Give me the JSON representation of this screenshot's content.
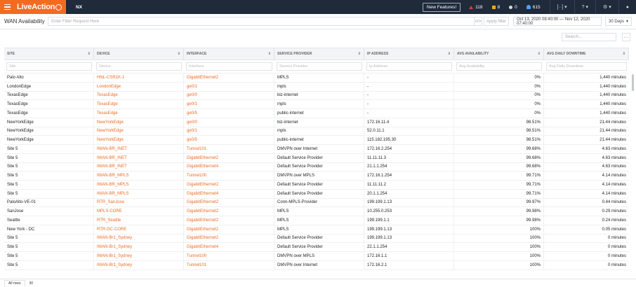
{
  "topbar": {
    "logo": "LiveAction",
    "app": "NX",
    "new_features": "New Features!",
    "alerts_red": "118",
    "alerts_orange": "8",
    "alerts_grey": "0",
    "notifications": "615",
    "colors": {
      "bar": "#1f2a3a",
      "accent": "#f26b21"
    }
  },
  "toolbar": {
    "title": "WAN Availability",
    "filter_placeholder": "Enter Filter Request Here",
    "apply": "Apply filter",
    "date_range": "Oct 13, 2020 08:40:00 — Nov 12, 2020 07:40:00",
    "period": "30 Days"
  },
  "search": {
    "placeholder": "Search..."
  },
  "table": {
    "columns": [
      "SITE",
      "DEVICE",
      "INTERFACE",
      "SERVICE PROVIDER",
      "IP ADDRESS",
      "AVG AVAILABILITY",
      "AVG DAILY DOWNTIME"
    ],
    "filters": [
      "Site",
      "Device",
      "Interface",
      "Service Provider",
      "Ip Address",
      "Avg Availability",
      "Avg Daily Downtime"
    ],
    "rows": [
      [
        "Palo Alto",
        "HNL-CSR1K-1",
        "GigabitEthernet2",
        "MPLS",
        "-",
        "0%",
        "1,440 minutes"
      ],
      [
        "LondonEdge",
        "LondonEdge",
        "ge0/1",
        "mpls",
        "-",
        "0%",
        "1,440 minutes"
      ],
      [
        "TexasEdge",
        "TexasEdge",
        "ge0/0",
        "biz-internet",
        "-",
        "0%",
        "1,440 minutes"
      ],
      [
        "TexasEdge",
        "TexasEdge",
        "ge0/1",
        "mpls",
        "-",
        "0%",
        "1,440 minutes"
      ],
      [
        "TexasEdge",
        "TexasEdge",
        "ge0/5",
        "public-internet",
        "-",
        "0%",
        "1,440 minutes"
      ],
      [
        "NewYorkEdge",
        "NewYorkEdge",
        "ge0/0",
        "biz-internet",
        "172.16.11.4",
        "98.51%",
        "21.44 minutes"
      ],
      [
        "NewYorkEdge",
        "NewYorkEdge",
        "ge0/1",
        "mpls",
        "52.0.11.1",
        "98.51%",
        "21.44 minutes"
      ],
      [
        "NewYorkEdge",
        "NewYorkEdge",
        "ge0/5",
        "public-internet",
        "115.182.195.30",
        "98.51%",
        "21.44 minutes"
      ],
      [
        "Site 5",
        "IWAN-BR_INET",
        "Tunnel101",
        "DMVPN over Internet",
        "172.16.2.254",
        "99.68%",
        "4.63 minutes"
      ],
      [
        "Site 5",
        "IWAN-BR_INET",
        "GigabitEthernet2",
        "Default Service Provider",
        "11.11.11.3",
        "99.68%",
        "4.63 minutes"
      ],
      [
        "Site 5",
        "IWAN-BR_INET",
        "GigabitEthernet4",
        "Default Service Provider",
        "21.1.1.254",
        "99.68%",
        "4.63 minutes"
      ],
      [
        "Site 5",
        "IWAN-BR_MPLS",
        "Tunnel100",
        "DMVPN over MPLS",
        "172.16.1.254",
        "99.71%",
        "4.14 minutes"
      ],
      [
        "Site 5",
        "IWAN-BR_MPLS",
        "GigabitEthernet2",
        "Default Service Provider",
        "11.11.11.2",
        "99.71%",
        "4.14 minutes"
      ],
      [
        "Site 5",
        "IWAN-BR_MPLS",
        "GigabitEthernet4",
        "Default Service Provider",
        "20.1.1.254",
        "99.71%",
        "4.14 minutes"
      ],
      [
        "PaloAlto-VE-01",
        "RTR_SanJose",
        "GigabitEthernet2",
        "Conn-MPLS-Provider",
        "199.199.1.13",
        "99.97%",
        "0.44 minutes"
      ],
      [
        "SanJose",
        "MPLS-CORE",
        "GigabitEthernet2",
        "MPLS",
        "10.255.0.253",
        "99.98%",
        "0.29 minutes"
      ],
      [
        "Seattle",
        "RTR_Seattle",
        "GigabitEthernet2",
        "MPLS",
        "199.199.1.1",
        "99.98%",
        "0.24 minutes"
      ],
      [
        "New York - DC",
        "RTR-DC-CORE",
        "GigabitEthernet2",
        "MPLS",
        "199.199.1.13",
        "100%",
        "0.05 minutes"
      ],
      [
        "Site 5",
        "IWAN-Br1_Sydney",
        "GigabitEthernet2",
        "Default Service Provider",
        "199.199.1.13",
        "100%",
        "0 minutes"
      ],
      [
        "Site 5",
        "IWAN-Br1_Sydney",
        "GigabitEthernet4",
        "Default Service Provider",
        "22.1.1.254",
        "100%",
        "0 minutes"
      ],
      [
        "Site 5",
        "IWAN-Br1_Sydney",
        "Tunnel100",
        "DMVPN over MPLS",
        "172.16.1.1",
        "100%",
        "0 minutes"
      ],
      [
        "Site 5",
        "IWAN-Br1_Sydney",
        "Tunnel101",
        "DMVPN over Internet",
        "172.16.2.1",
        "100%",
        "0 minutes"
      ]
    ]
  },
  "footer": {
    "tab": "All rows",
    "count": "30"
  }
}
